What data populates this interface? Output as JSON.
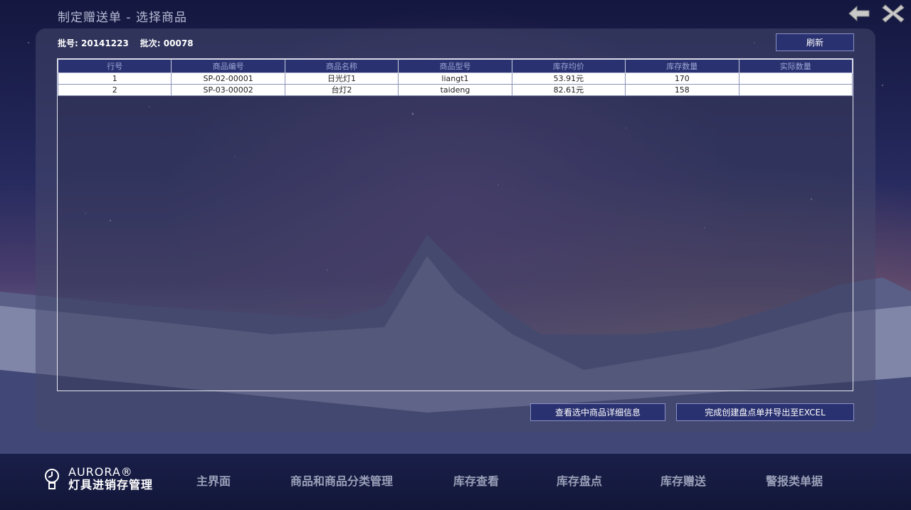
{
  "window": {
    "title": "制定赠送单 - 选择商品"
  },
  "icons": {
    "back": "back-arrow-icon",
    "close": "close-icon"
  },
  "batch": {
    "number_label": "批号:",
    "number_value": "20141223",
    "lot_label": "批次:",
    "lot_value": "00078"
  },
  "buttons": {
    "refresh": "刷新",
    "view_detail": "查看选中商品详细信息",
    "finish_export": "完成创建盘点单并导出至EXCEL"
  },
  "table": {
    "columns": [
      "行号",
      "商品编号",
      "商品名称",
      "商品型号",
      "库存均价",
      "库存数量",
      "实际数量"
    ],
    "rows": [
      [
        "1",
        "SP-02-00001",
        "日光灯1",
        "liangt1",
        "53.91元",
        "170",
        ""
      ],
      [
        "2",
        "SP-03-00002",
        "台灯2",
        "taideng",
        "82.61元",
        "158",
        ""
      ]
    ]
  },
  "footer": {
    "logo_en": "AURORA®",
    "logo_cn": "灯具进销存管理",
    "nav": [
      "主界面",
      "商品和商品分类管理",
      "库存查看",
      "库存盘点",
      "库存赠送",
      "警报类单据"
    ]
  },
  "colors": {
    "accent": "#2a3170",
    "header_text": "#9ea6d6",
    "title_text": "#b8bcd4"
  }
}
